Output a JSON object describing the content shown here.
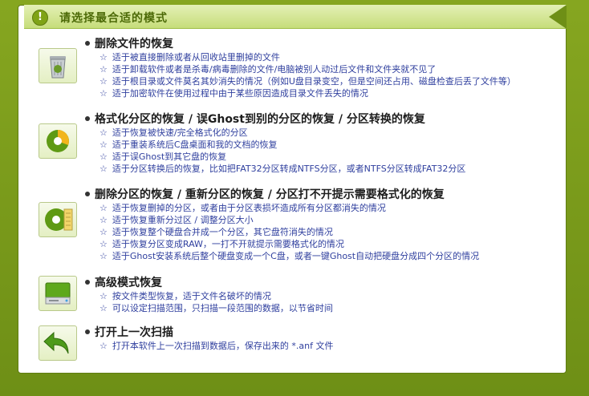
{
  "header": {
    "title": "请选择最合适的模式"
  },
  "sections": [
    {
      "title": "删除文件的恢复",
      "icon": "recycle-bin-icon",
      "items": [
        "适于被直接删除或者从回收站里删掉的文件",
        "适于卸载软件或者是杀毒/病毒删除的文件/电脑被别人动过后文件和文件夹就不见了",
        "适于根目录或文件莫名其妙消失的情况（例如U盘目录变空，但是空间还占用、磁盘检查后丢了文件等）",
        "适于加密软件在使用过程中由于某些原因造成目录文件丢失的情况"
      ]
    },
    {
      "title": "格式化分区的恢复 / 误Ghost到别的分区的恢复 / 分区转换的恢复",
      "icon": "disk-pie-icon",
      "items": [
        "适于恢复被快速/完全格式化的分区",
        "适于重装系统后C盘桌面和我的文档的恢复",
        "适于误Ghost到其它盘的恢复",
        "适于分区转换后的恢复，比如把FAT32分区转成NTFS分区，或者NTFS分区转成FAT32分区"
      ]
    },
    {
      "title": "删除分区的恢复 / 重新分区的恢复 / 分区打不开提示需要格式化的恢复",
      "icon": "partition-icon",
      "items": [
        "适于恢复删掉的分区，或者由于分区表损坏造成所有分区都消失的情况",
        "适于恢复重新分过区 / 调整分区大小",
        "适于恢复整个硬盘合并成一个分区，其它盘符消失的情况",
        "适于恢复分区变成RAW，一打不开就提示需要格式化的情况",
        "适于Ghost安装系统后整个硬盘变成一个C盘，或者一键Ghost自动把硬盘分成四个分区的情况"
      ]
    },
    {
      "title": "高级模式恢复",
      "icon": "hard-drive-icon",
      "items": [
        "按文件类型恢复，适于文件名破坏的情况",
        "可以设定扫描范围，只扫描一段范围的数据，以节省时间"
      ]
    },
    {
      "title": "打开上一次扫描",
      "icon": "undo-arrow-icon",
      "items": [
        "打开本软件上一次扫描到数据后，保存出来的 *.anf 文件"
      ]
    }
  ],
  "colors": {
    "frame": "#7a9a1c",
    "header": "#d4e79a",
    "item_text": "#2f3f9e"
  }
}
